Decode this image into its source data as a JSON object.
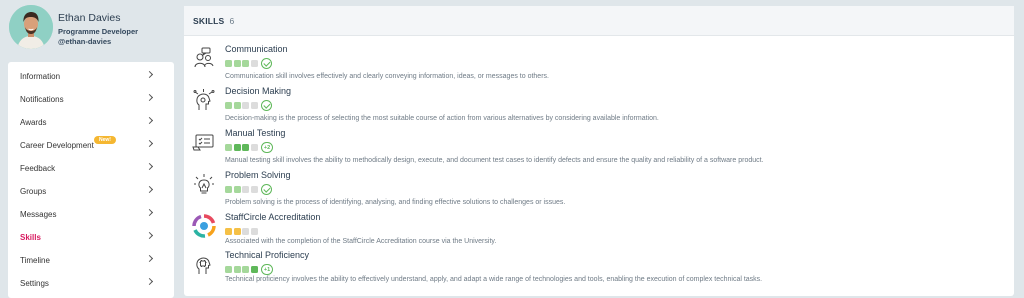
{
  "profile": {
    "name": "Ethan Davies",
    "role": "Programme Developer",
    "handle": "@ethan-davies"
  },
  "nav": {
    "items": [
      {
        "label": "Information"
      },
      {
        "label": "Notifications"
      },
      {
        "label": "Awards"
      },
      {
        "label": "Career Development",
        "badge": "New!"
      },
      {
        "label": "Feedback"
      },
      {
        "label": "Groups"
      },
      {
        "label": "Messages"
      },
      {
        "label": "Skills",
        "active": true
      },
      {
        "label": "Timeline"
      },
      {
        "label": "Settings"
      }
    ]
  },
  "skills_panel": {
    "title": "SKILLS",
    "count": "6",
    "skills": [
      {
        "name": "Communication",
        "icon": "people-talking-icon",
        "level": 3,
        "max": 4,
        "color": "green",
        "status": "check",
        "description": "Communication skill involves effectively and clearly conveying information, ideas, or messages to others."
      },
      {
        "name": "Decision Making",
        "icon": "decision-head-icon",
        "level": 2,
        "max": 4,
        "color": "green",
        "status": "check",
        "description": "Decision-making is the process of selecting the most suitable course of action from various alternatives by considering available information."
      },
      {
        "name": "Manual Testing",
        "icon": "checklist-testing-icon",
        "level": 3,
        "max": 4,
        "color": "green",
        "status": "plus",
        "status_text": "+2",
        "description": "Manual testing skill involves the ability to methodically design, execute, and document test cases to identify defects and ensure the quality and reliability of a software product."
      },
      {
        "name": "Problem Solving",
        "icon": "lightbulb-icon",
        "level": 2,
        "max": 4,
        "color": "green",
        "status": "check",
        "description": "Problem solving is the process of identifying, analysing, and finding effective solutions to challenges or issues."
      },
      {
        "name": "StaffCircle Accreditation",
        "icon": "staffcircle-logo-icon",
        "level": 2,
        "max": 4,
        "color": "yellow",
        "status": "none",
        "description": "Associated with the completion of the StaffCircle Accreditation course via the University."
      },
      {
        "name": "Technical Proficiency",
        "icon": "brain-chip-icon",
        "level": 4,
        "max": 4,
        "color": "green",
        "status": "plus",
        "status_text": "+1",
        "description": "Technical proficiency involves the ability to effectively understand, apply, and adapt a wide range of technologies and tools, enabling the execution of complex technical tasks."
      }
    ]
  }
}
